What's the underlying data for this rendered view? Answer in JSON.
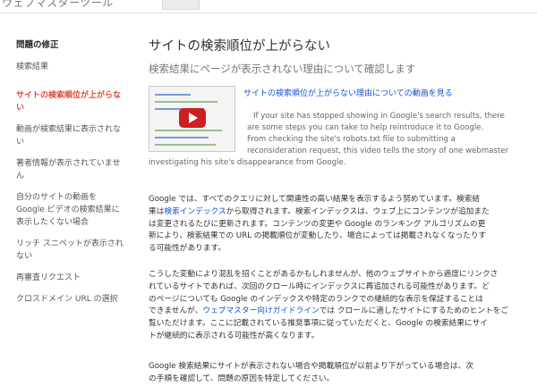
{
  "topbar": {
    "crumb": "ウェブマスターツール"
  },
  "sidebar": {
    "heading": "問題の修正",
    "items": [
      {
        "label": "検索結果"
      },
      {
        "label": "サイトの検索順位が上がらない"
      },
      {
        "label": "動画が検索結果に表示されない"
      },
      {
        "label": "著者情報が表示されていません"
      },
      {
        "label": "自分のサイトの動画を Google ビデオの検索結果に表示したくない場合"
      },
      {
        "label": "リッチ スニペットが表示されない"
      },
      {
        "label": "再審査リクエスト"
      },
      {
        "label": "クロスドメイン URL の選択"
      }
    ]
  },
  "main": {
    "title": "サイトの検索順位が上がらない",
    "subtitle": "検索結果にページが表示されない理由について確認します",
    "video_link": "サイトの検索順位が上がらない理由についての動画を見る",
    "video_desc": [
      "If your site has stopped showing in Google's search results, there",
      "are some steps you can take to help reintroduce it to Google.",
      "From checking the site's robots.txt file to submitting a",
      "reconsideration request, this video tells the story of one webmaster",
      "investigating his site's disappearance from Google."
    ],
    "p1": {
      "a": "Google では、すべてのクエリに対して関連性の高い結果を表示するよう努めています。検索結",
      "b_pre": "果は",
      "b_link": "検索インデックス",
      "b_post": "から取得されます。検索インデックスは、ウェブ上にコンテンツが追加また",
      "c": "は変更されるたびに更新されます。コンテンツの変更や Google のランキング アルゴリズムの更",
      "d": "新により、検索結果での URL の掲載順位が変動したり、場合によっては掲載されなくなったりす",
      "e": "る可能性があります。"
    },
    "p2": {
      "a": "こうした変動により混乱を招くことがあるかもしれませんが、他のウェブサイトから適度にリンクさ",
      "b": "れているサイトであれば、次回のクロール時にインデックスに再追加される可能性があります。ど",
      "c": "のページについても Google のインデックスや特定のランクでの継続的な表示を保証することは",
      "d_pre": "できませんが、",
      "d_link": "ウェブマスター向けガイドライン",
      "d_post": "では クロールに適したサイトにするためのヒントをご",
      "e": "覧いただけます。ここに記載されている推奨事項に従っていただくと、Google の検索結果にサイ",
      "f": "トが継続的に表示される可能性が高くなります。"
    },
    "p3": {
      "a": "Google 検索結果にサイトが表示されない場合や掲載順位が以前より下がっている場合は、次",
      "b": "の手順を確認して、問題の原因を特定してください。"
    }
  }
}
